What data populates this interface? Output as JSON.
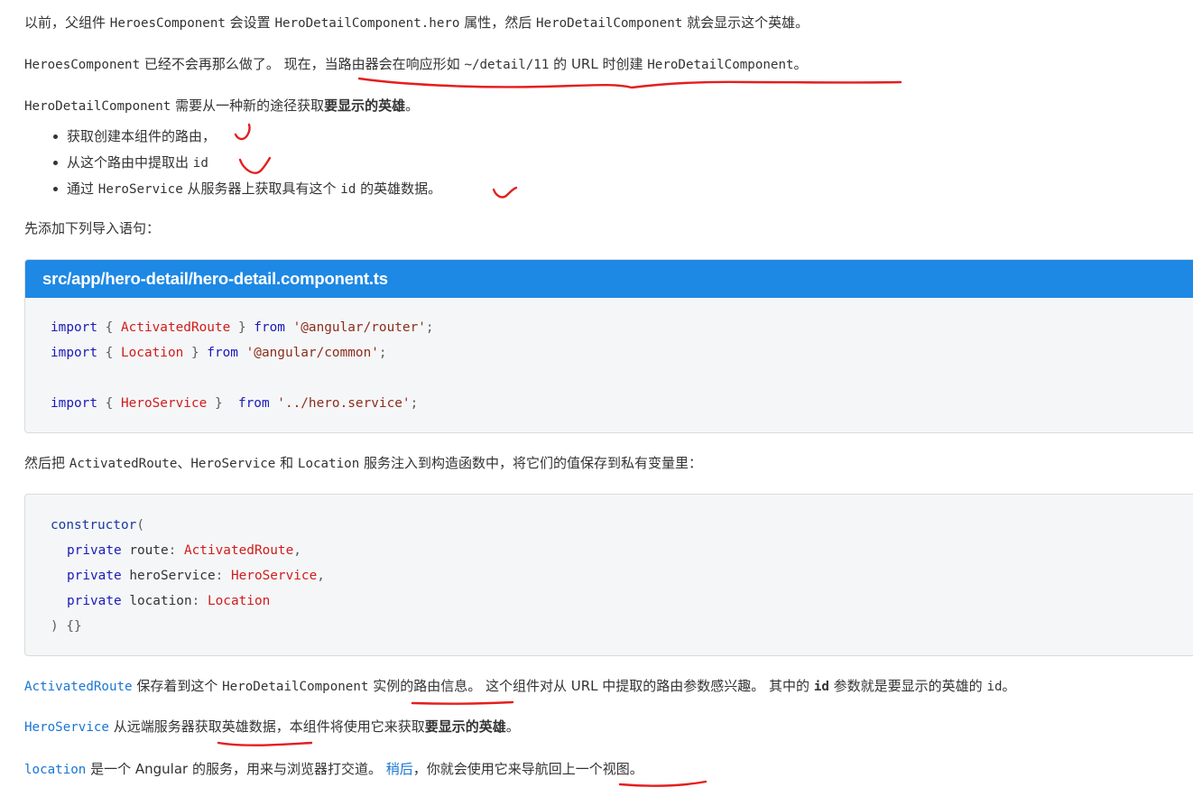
{
  "para1": {
    "t1": "以前，父组件 ",
    "c1": "HeroesComponent",
    "t2": " 会设置 ",
    "c2": "HeroDetailComponent.hero",
    "t3": " 属性，然后 ",
    "c3": "HeroDetailComponent",
    "t4": " 就会显示这个英雄。"
  },
  "para2": {
    "c1": "HeroesComponent",
    "t1": " 已经不会再那么做了。 现在，当路由器会在响应形如 ",
    "c2": "~/detail/11",
    "t2": " 的 URL 时创建 ",
    "c3": "HeroDetailComponent",
    "t3": "。"
  },
  "para3": {
    "c1": "HeroDetailComponent",
    "t1": " 需要从一种新的途径获取",
    "b1": "要显示的英雄",
    "t2": "。"
  },
  "bullets": {
    "item1": "获取创建本组件的路由，",
    "item2_text": "从这个路由中提取出 ",
    "item2_code": "id",
    "item3_t1": "通过 ",
    "item3_c1": "HeroService",
    "item3_t2": " 从服务器上获取具有这个 ",
    "item3_c2": "id",
    "item3_t3": " 的英雄数据。"
  },
  "para4": "先添加下列导入语句：",
  "codebox1": {
    "filename": "src/app/hero-detail/hero-detail.component.ts",
    "l1": {
      "kw": "import",
      "ob": " { ",
      "ty": "ActivatedRoute",
      "cb": " } ",
      "from": "from",
      "sp": " ",
      "str": "'@angular/router'",
      "semi": ";"
    },
    "l2": {
      "kw": "import",
      "ob": " { ",
      "ty": "Location",
      "cb": " } ",
      "from": "from",
      "sp": " ",
      "str": "'@angular/common'",
      "semi": ";"
    },
    "l3": {
      "kw": "import",
      "ob": " { ",
      "ty": "HeroService",
      "cb": " }  ",
      "from": "from",
      "sp": " ",
      "str": "'../hero.service'",
      "semi": ";"
    }
  },
  "para5": {
    "t1": "然后把 ",
    "c1": "ActivatedRoute",
    "t2": "、",
    "c2": "HeroService",
    "t3": " 和 ",
    "c3": "Location",
    "t4": " 服务注入到构造函数中，将它们的值保存到私有变量里："
  },
  "codebox2": {
    "l1_fn": "constructor",
    "l1_p": "(",
    "l2_kw": "private",
    "l2_name": " route",
    "l2_colon": ": ",
    "l2_ty": "ActivatedRoute",
    "l2_comma": ",",
    "l3_kw": "private",
    "l3_name": " heroService",
    "l3_colon": ": ",
    "l3_ty": "HeroService",
    "l3_comma": ",",
    "l4_kw": "private",
    "l4_name": " location",
    "l4_colon": ": ",
    "l4_ty": "Location",
    "l5": ") {}"
  },
  "para6": {
    "c1": "ActivatedRoute",
    "t1": " 保存着到这个 ",
    "c2": "HeroDetailComponent",
    "t2": " 实例的路由信息。 这个组件对从 URL 中提取的路由参数感兴趣。 其中的 ",
    "c3": "id",
    "t3": " 参数就是要显示的英雄的 ",
    "c4": "id",
    "t4": "。"
  },
  "para7": {
    "c1": "HeroService",
    "t1": " 从远端服务器获取英雄数据，本组件将使用它来获取",
    "b1": "要显示的英雄",
    "t2": "。"
  },
  "para8": {
    "c1": "location",
    "t1": " 是一个 Angular 的服务，用来与浏览器打交道。 ",
    "link1": "稍后",
    "t2": "，你就会使用它来导航回上一个视图。"
  },
  "colors": {
    "link": "#1976d2",
    "header": "#1e88e5",
    "annotation": "#e41e1e",
    "keyword": "#1a1ab8",
    "type": "#d01c1c"
  }
}
